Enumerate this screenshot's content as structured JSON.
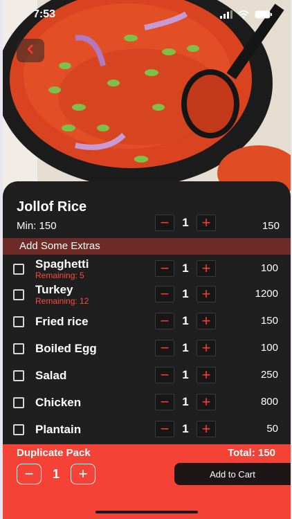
{
  "status_bar": {
    "time": "7:53"
  },
  "dish": {
    "title": "Jollof Rice",
    "min_label": "Min: 150",
    "quantity": "1",
    "price": "150"
  },
  "extras_header": "Add Some Extras",
  "extras": [
    {
      "name": "Spaghetti",
      "remaining": "Remaining: 5",
      "quantity": "1",
      "price": "100"
    },
    {
      "name": "Turkey",
      "remaining": "Remaining: 12",
      "quantity": "1",
      "price": "1200"
    },
    {
      "name": "Fried rice",
      "remaining": "",
      "quantity": "1",
      "price": "150"
    },
    {
      "name": "Boiled Egg",
      "remaining": "",
      "quantity": "1",
      "price": "100"
    },
    {
      "name": "Salad",
      "remaining": "",
      "quantity": "1",
      "price": "250"
    },
    {
      "name": "Chicken",
      "remaining": "",
      "quantity": "1",
      "price": "800"
    },
    {
      "name": "Plantain",
      "remaining": "",
      "quantity": "1",
      "price": "50"
    }
  ],
  "footer": {
    "duplicate_label": "Duplicate Pack",
    "total_label": "Total: 150",
    "pack_quantity": "1",
    "add_to_cart": "Add to Cart"
  },
  "icons": {
    "back": "chevron-left-icon",
    "minus": "minus-icon",
    "plus": "plus-icon",
    "wifi": "wifi-icon",
    "battery": "battery-icon",
    "signal": "signal-icon"
  },
  "colors": {
    "accent": "#f44336",
    "sheet": "#1f1f1f",
    "extras_bar": "#6e2a26",
    "stepper_icon": "#ff3b30"
  }
}
